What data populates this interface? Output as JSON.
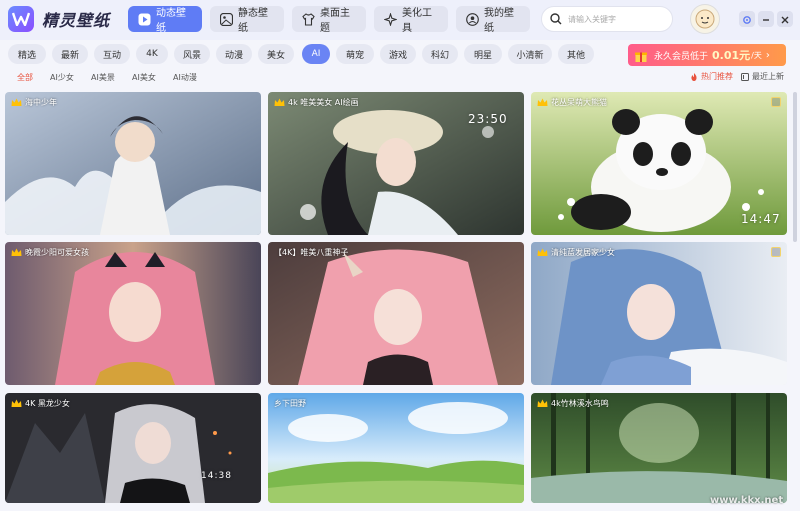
{
  "app": {
    "title": "精灵壁纸"
  },
  "nav": [
    {
      "label": "动态壁纸",
      "active": true,
      "icon": "play-icon"
    },
    {
      "label": "静态壁纸",
      "active": false,
      "icon": "image-icon"
    },
    {
      "label": "桌面主题",
      "active": false,
      "icon": "shirt-icon"
    },
    {
      "label": "美化工具",
      "active": false,
      "icon": "sparkle-icon"
    },
    {
      "label": "我的壁纸",
      "active": false,
      "icon": "user-icon"
    }
  ],
  "search": {
    "placeholder": "请输入关键字"
  },
  "categories": [
    "精选",
    "最新",
    "互动",
    "4K",
    "风景",
    "动漫",
    "美女",
    "AI",
    "萌宠",
    "游戏",
    "科幻",
    "明星",
    "小清新",
    "其他"
  ],
  "active_category": "AI",
  "vip": {
    "text": "永久会员低于",
    "price": "0.01元",
    "unit": "/天"
  },
  "subcategories": [
    "全部",
    "AI少女",
    "AI美景",
    "AI美女",
    "AI动漫"
  ],
  "active_subcategory": "全部",
  "sort": {
    "hot": "热门推荐",
    "latest": "最近上新"
  },
  "cards": [
    {
      "title": "海中少年"
    },
    {
      "title": "4k 唯美美女 AI绘画",
      "clock": "23:50"
    },
    {
      "title": "花丛呆萌大熊猫",
      "clock": "14:47"
    },
    {
      "title": "晚霞少阳可爱女孩"
    },
    {
      "title": "【4K】唯美八重神子"
    },
    {
      "title": "清纯蓝发居家少女"
    },
    {
      "title": "4K 黑龙少女",
      "clock": "14:38"
    },
    {
      "title": "乡下田野"
    },
    {
      "title": "4k竹林溪水鸟鸣"
    }
  ],
  "watermark": "www.kkx.net",
  "colors": {
    "accent": "#5f7cf5",
    "hot": "#e8533f"
  }
}
